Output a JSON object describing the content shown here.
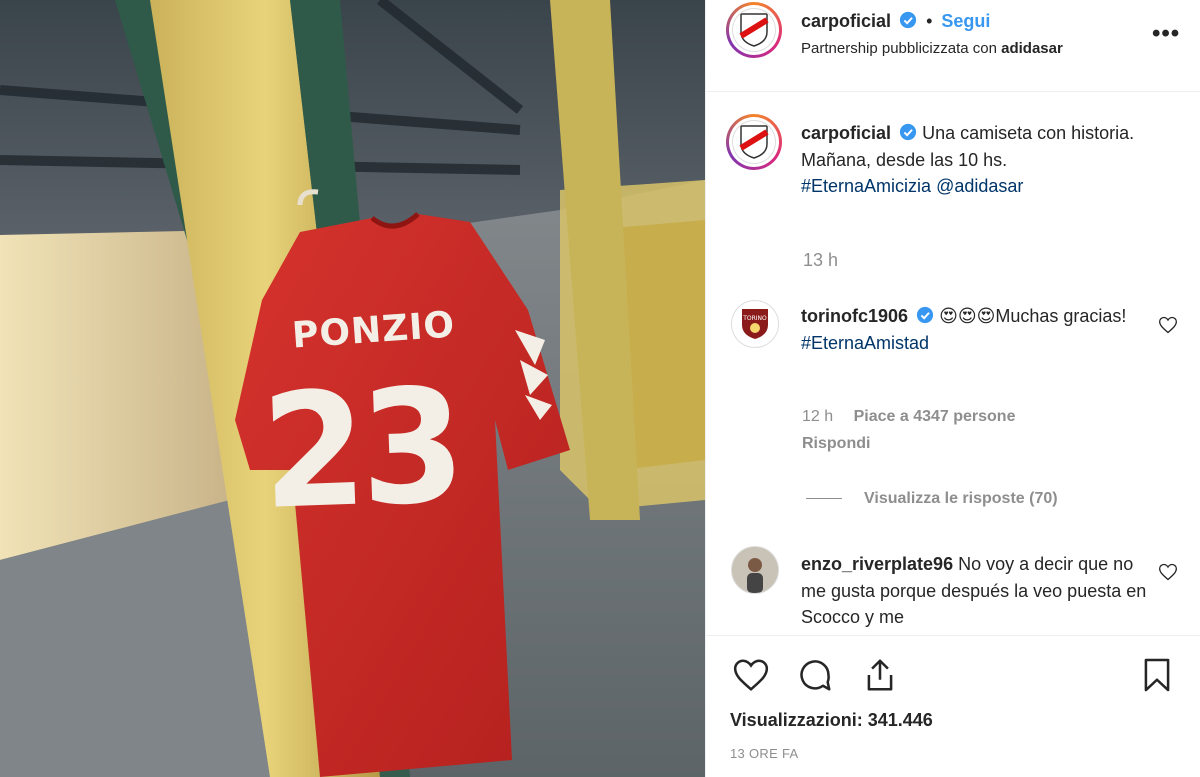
{
  "post": {
    "username": "carpoficial",
    "follow_label": "Segui",
    "separator": "•",
    "partnership_prefix": "Partnership pubblicizzata con",
    "partner": "adidasar",
    "more_label": "•••"
  },
  "media": {
    "jersey_name": "PONZIO",
    "jersey_number": "23"
  },
  "caption": {
    "username": "carpoficial",
    "line1": "Una camiseta con historia.",
    "line2": "Mañana, desde las 10 hs.",
    "hashtag": "#EternaAmicizia",
    "mention": "@adidasar",
    "time": "13 h"
  },
  "comments": [
    {
      "username": "torinofc1906",
      "emoji": "😍😍😍",
      "text": "Muchas gracias!",
      "hashtag": "#EternaAmistad",
      "time": "12 h",
      "likes": "Piace a 4347 persone",
      "reply": "Rispondi",
      "view_replies": "Visualizza le risposte (70)"
    },
    {
      "username": "enzo_riverplate96",
      "text": "No voy a decir que no me gusta porque después la veo puesta en Scocco y me"
    }
  ],
  "footer": {
    "views": "Visualizzazioni: 341.446",
    "date": "13 ORE FA"
  },
  "colors": {
    "link_blue": "#3897f0",
    "hashtag_blue": "#003569",
    "muted": "#8e8e8e",
    "verified": "#3897f0",
    "heart_emoji": "#e0245e"
  },
  "icons": [
    "more-icon",
    "verified-icon",
    "heart-icon",
    "comment-icon",
    "share-icon",
    "bookmark-icon"
  ]
}
